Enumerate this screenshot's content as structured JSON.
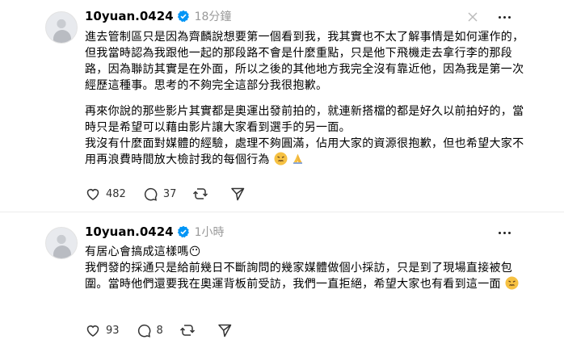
{
  "posts": [
    {
      "username": "10yuan.0424",
      "time": "18分鐘",
      "paragraph1": "進去管制區只是因為齊麟說想要第一個看到我，我其實也不太了解事情是如何運作的，但我當時認為我跟他一起的那段路不會是什麼重點，只是他下飛機走去拿行李的那段路，因為聯訪其實是在外面，所以之後的其他地方我完全沒有靠近他，因為我是第一次經歷這種事。思考的不夠完全這部分我很抱歉。",
      "paragraph2a": "再來你說的那些影片其實都是奧運出發前拍的，就連新搭檔的都是好久以前拍好的，當時只是希望可以藉由影片讓大家看到選手的另一面。",
      "paragraph2b": "我沒有什麼面對媒體的經驗，處理不夠圓滿，佔用大家的資源很抱歉，但也希望大家不用再浪費時間放大檢討我的每個行為",
      "emojis": [
        "persevering-face",
        "folded-hands"
      ],
      "likes": "482",
      "comments": "37"
    },
    {
      "username": "10yuan.0424",
      "time": "1小時",
      "line1": "有居心會搞成這樣嗎😶",
      "paragraph": "我們發的採通只是給前幾日不斷詢問的幾家媒體做個小採訪，只是到了現場直接被包圍。當時他們還要我在奧運背板前受訪，我們一直拒絕，希望大家也有看到這一面",
      "emojis": [
        "persevering-face"
      ],
      "likes": "93",
      "comments": "8"
    }
  ],
  "colors": {
    "verified": "#0095f6",
    "muted": "#999999",
    "emoji_face": "#f6c142"
  }
}
